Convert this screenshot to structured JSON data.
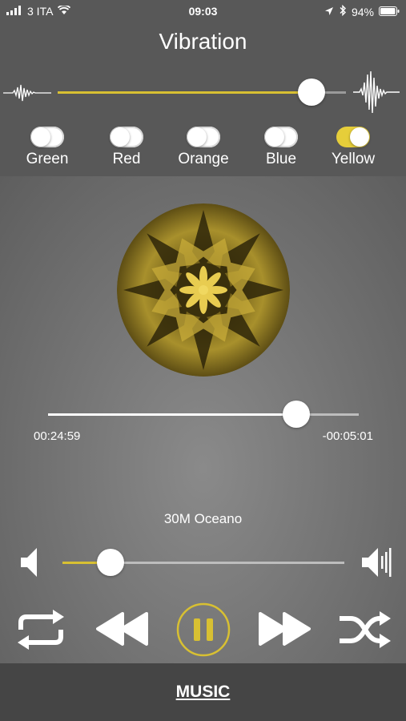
{
  "status_bar": {
    "carrier": "3 ITA",
    "time": "09:03",
    "battery": "94%"
  },
  "header": {
    "title": "Vibration"
  },
  "vibration": {
    "level": 0.88
  },
  "color_toggles": [
    {
      "label": "Green",
      "on": false
    },
    {
      "label": "Red",
      "on": false
    },
    {
      "label": "Orange",
      "on": false
    },
    {
      "label": "Blue",
      "on": false
    },
    {
      "label": "Yellow",
      "on": true
    }
  ],
  "player": {
    "elapsed": "00:24:59",
    "remaining": "-00:05:01",
    "progress": 0.8,
    "song_title": "30M Oceano",
    "volume": 0.17
  },
  "colors": {
    "accent": "#d8c032",
    "toggle_on": "#e6ce3a",
    "art_gold": "#b59a2a"
  },
  "icons": [
    "signal-icon",
    "wifi-icon",
    "location-icon",
    "bluetooth-icon",
    "battery-icon",
    "waveform-small-icon",
    "waveform-large-icon",
    "volume-low-icon",
    "volume-high-icon",
    "repeat-icon",
    "rewind-icon",
    "pause-icon",
    "fast-forward-icon",
    "shuffle-icon"
  ],
  "bottom_bar": {
    "tab_label": "MUSIC"
  }
}
